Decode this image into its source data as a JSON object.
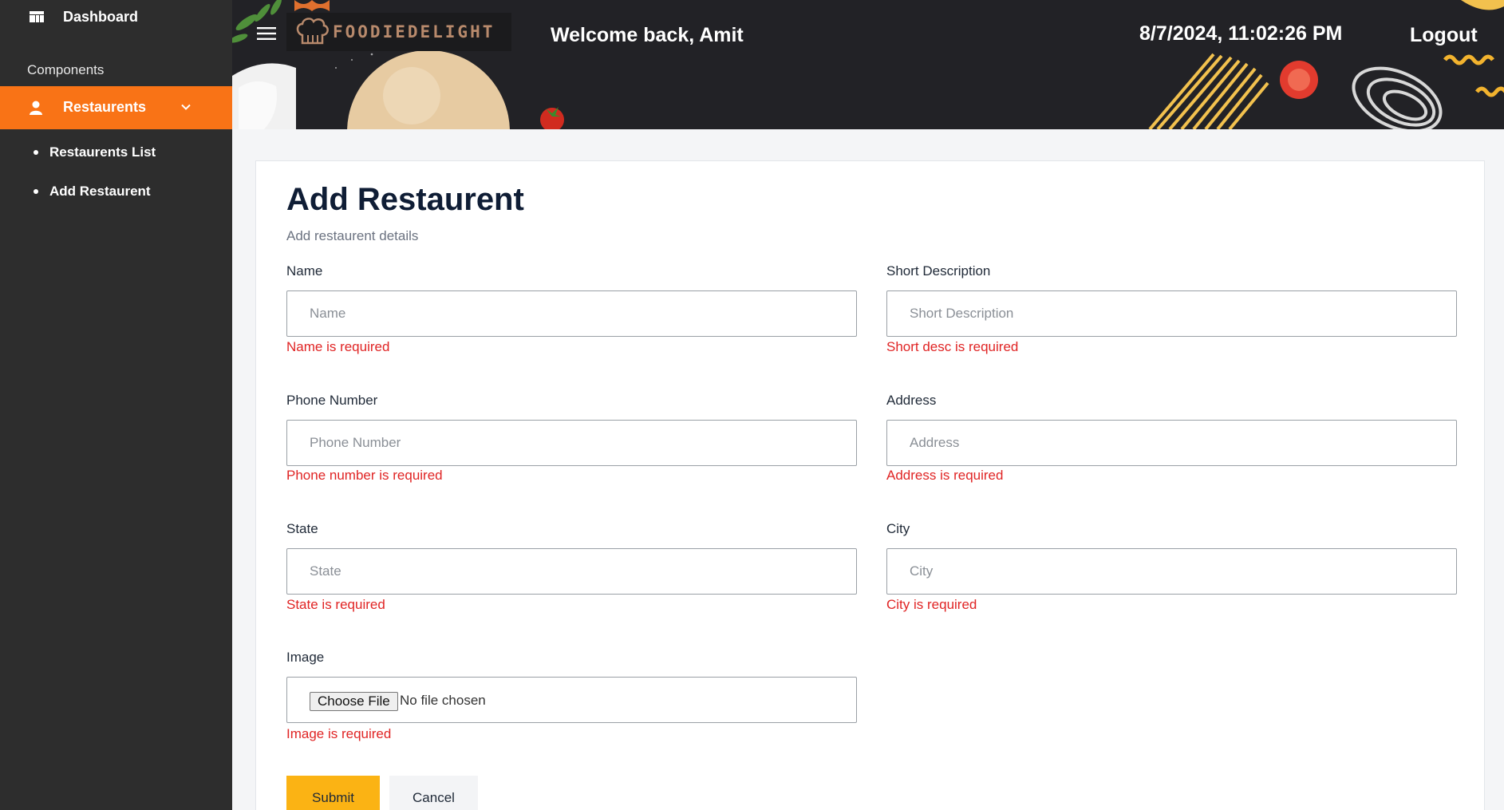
{
  "sidebar": {
    "dashboard_label": "Dashboard",
    "section_label": "Components",
    "restaurents_label": "Restaurents",
    "sub_items": [
      "Restaurents List",
      "Add Restaurent"
    ],
    "active_color": "#f97316"
  },
  "header": {
    "brand": "FOODIEDELIGHT",
    "welcome": "Welcome back, Amit",
    "datetime": "8/7/2024, 11:02:26 PM",
    "logout": "Logout"
  },
  "form": {
    "title": "Add Restaurent",
    "subtitle": "Add restaurent details",
    "fields": [
      {
        "label": "Name",
        "placeholder": "Name",
        "error": "Name is required"
      },
      {
        "label": "Short Description",
        "placeholder": "Short Description",
        "error": "Short desc is required"
      },
      {
        "label": "Phone Number",
        "placeholder": "Phone Number",
        "error": "Phone number is required"
      },
      {
        "label": "Address",
        "placeholder": "Address",
        "error": "Address is required"
      },
      {
        "label": "State",
        "placeholder": "State",
        "error": "State is required"
      },
      {
        "label": "City",
        "placeholder": "City",
        "error": "City is required"
      }
    ],
    "image": {
      "label": "Image",
      "button": "Choose File",
      "status": "No file chosen",
      "error": "Image is required"
    },
    "submit": "Submit",
    "cancel": "Cancel",
    "error_color": "#e02424",
    "submit_color": "#fbb314"
  }
}
